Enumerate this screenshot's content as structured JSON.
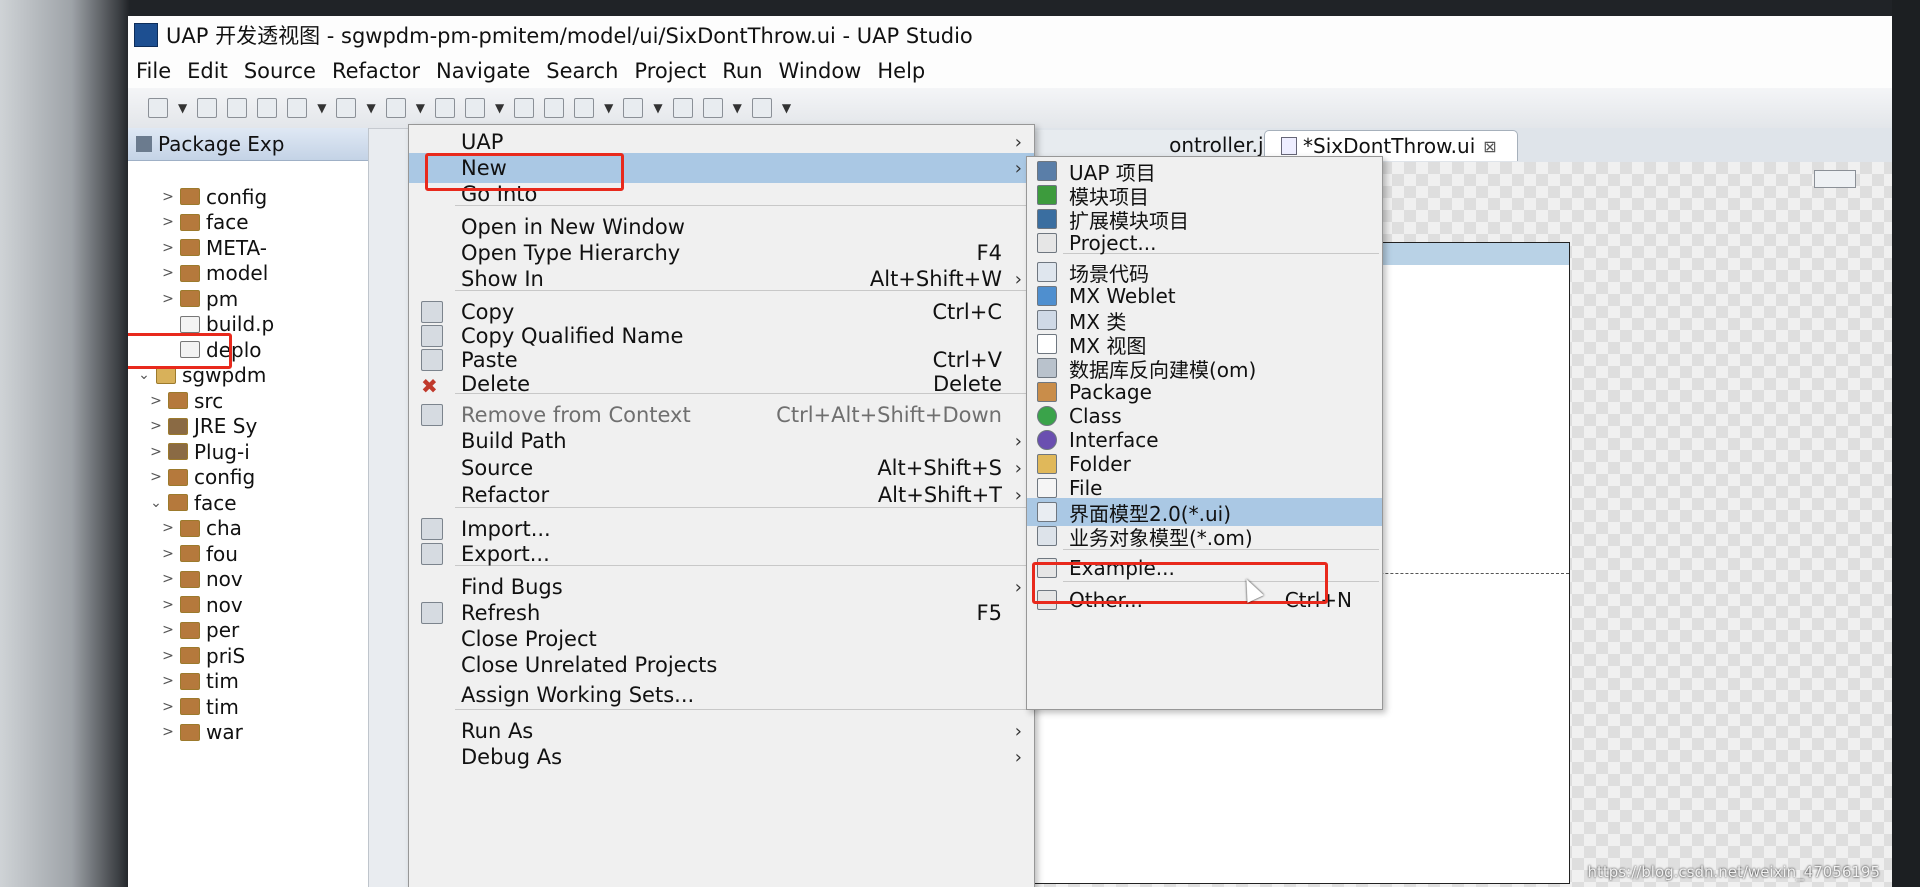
{
  "window": {
    "title": "UAP 开发透视图 - sgwpdm-pm-pmitem/model/ui/SixDontThrow.ui - UAP Studio"
  },
  "menubar": [
    "File",
    "Edit",
    "Source",
    "Refactor",
    "Navigate",
    "Search",
    "Project",
    "Run",
    "Window",
    "Help"
  ],
  "package_explorer": {
    "tab_label": "Package Exp",
    "items": [
      {
        "label": "config",
        "type": "folder",
        "expander": ">"
      },
      {
        "label": "face",
        "type": "folder",
        "expander": ">"
      },
      {
        "label": "META-",
        "type": "folder",
        "expander": ">"
      },
      {
        "label": "model",
        "type": "folder",
        "expander": ">"
      },
      {
        "label": "pm",
        "type": "folder",
        "expander": ">"
      },
      {
        "label": "build.p",
        "type": "file",
        "expander": ""
      },
      {
        "label": "deplo",
        "type": "file",
        "expander": ""
      },
      {
        "label": "sgwpdm",
        "type": "project",
        "expander": "⌄"
      },
      {
        "label": "src",
        "type": "folder",
        "expander": ">"
      },
      {
        "label": "JRE Sy",
        "type": "lib",
        "expander": ">"
      },
      {
        "label": "Plug-i",
        "type": "lib",
        "expander": ">"
      },
      {
        "label": "config",
        "type": "folder",
        "expander": ">"
      },
      {
        "label": "face",
        "type": "folder",
        "expander": "⌄"
      },
      {
        "label": "cha",
        "type": "folder",
        "expander": ">"
      },
      {
        "label": "fou",
        "type": "folder",
        "expander": ">"
      },
      {
        "label": "nov",
        "type": "folder",
        "expander": ">"
      },
      {
        "label": "nov",
        "type": "folder",
        "expander": ">"
      },
      {
        "label": "per",
        "type": "folder",
        "expander": ">"
      },
      {
        "label": "priS",
        "type": "folder",
        "expander": ">"
      },
      {
        "label": "tim",
        "type": "folder",
        "expander": ">"
      },
      {
        "label": "tim",
        "type": "folder",
        "expander": ">"
      },
      {
        "label": "war",
        "type": "folder",
        "expander": ">"
      }
    ]
  },
  "editor": {
    "tabs": [
      {
        "label": "ontroller.js"
      },
      {
        "label": "*SixDontThrow.ui",
        "close": "⊠"
      }
    ]
  },
  "context_menu": {
    "items": [
      {
        "label": "UAP",
        "submenu": true
      },
      {
        "label": "New",
        "submenu": true,
        "highlighted": true
      },
      {
        "label": "Go Into"
      },
      {
        "label": "Open in New Window"
      },
      {
        "label": "Open Type Hierarchy",
        "shortcut": "F4"
      },
      {
        "label": "Show In",
        "shortcut": "Alt+Shift+W",
        "submenu": true
      },
      {
        "label": "Copy",
        "shortcut": "Ctrl+C",
        "icon": "copy-icon"
      },
      {
        "label": "Copy Qualified Name",
        "icon": "copy-qualified-icon"
      },
      {
        "label": "Paste",
        "shortcut": "Ctrl+V",
        "icon": "paste-icon"
      },
      {
        "label": "Delete",
        "shortcut": "Delete",
        "icon": "delete-icon"
      },
      {
        "label": "Remove from Context",
        "shortcut": "Ctrl+Alt+Shift+Down",
        "disabled": true,
        "icon": "remove-context-icon"
      },
      {
        "label": "Build Path",
        "submenu": true
      },
      {
        "label": "Source",
        "shortcut": "Alt+Shift+S",
        "submenu": true
      },
      {
        "label": "Refactor",
        "shortcut": "Alt+Shift+T",
        "submenu": true
      },
      {
        "label": "Import...",
        "icon": "import-icon"
      },
      {
        "label": "Export...",
        "icon": "export-icon"
      },
      {
        "label": "Find Bugs",
        "submenu": true
      },
      {
        "label": "Refresh",
        "shortcut": "F5",
        "icon": "refresh-icon"
      },
      {
        "label": "Close Project"
      },
      {
        "label": "Close Unrelated Projects"
      },
      {
        "label": "Assign Working Sets..."
      },
      {
        "label": "Run As",
        "submenu": true
      },
      {
        "label": "Debug As",
        "submenu": true
      }
    ]
  },
  "new_submenu": {
    "items": [
      {
        "label": "UAP 项目",
        "icon": "uap-project-icon"
      },
      {
        "label": "模块项目",
        "icon": "module-project-icon"
      },
      {
        "label": "扩展模块项目",
        "icon": "ext-module-icon"
      },
      {
        "label": "Project...",
        "icon": "project-icon"
      },
      {
        "label": "场景代码",
        "icon": "scene-code-icon"
      },
      {
        "label": "MX Weblet",
        "icon": "weblet-icon"
      },
      {
        "label": "MX 类",
        "icon": "mx-class-icon"
      },
      {
        "label": "MX 视图",
        "icon": "mx-view-icon"
      },
      {
        "label": "数据库反向建模(om)",
        "icon": "db-reverse-icon"
      },
      {
        "label": "Package",
        "icon": "package-icon"
      },
      {
        "label": "Class",
        "icon": "class-icon"
      },
      {
        "label": "Interface",
        "icon": "interface-icon"
      },
      {
        "label": "Folder",
        "icon": "folder-icon"
      },
      {
        "label": "File",
        "icon": "file-icon"
      },
      {
        "label": "界面模型2.0(*.ui)",
        "icon": "ui-model-icon",
        "highlighted": true
      },
      {
        "label": "业务对象模型(*.om)",
        "icon": "om-model-icon"
      },
      {
        "label": "Example...",
        "icon": "example-icon"
      },
      {
        "label": "Other...",
        "shortcut": "Ctrl+N",
        "icon": "other-icon"
      }
    ]
  },
  "watermark": "https://blog.csdn.net/weixin_47056195",
  "colors": {
    "highlight": "#aac8e4",
    "annotation_box": "#e8291c",
    "menu_bg": "#f0f0f0"
  }
}
